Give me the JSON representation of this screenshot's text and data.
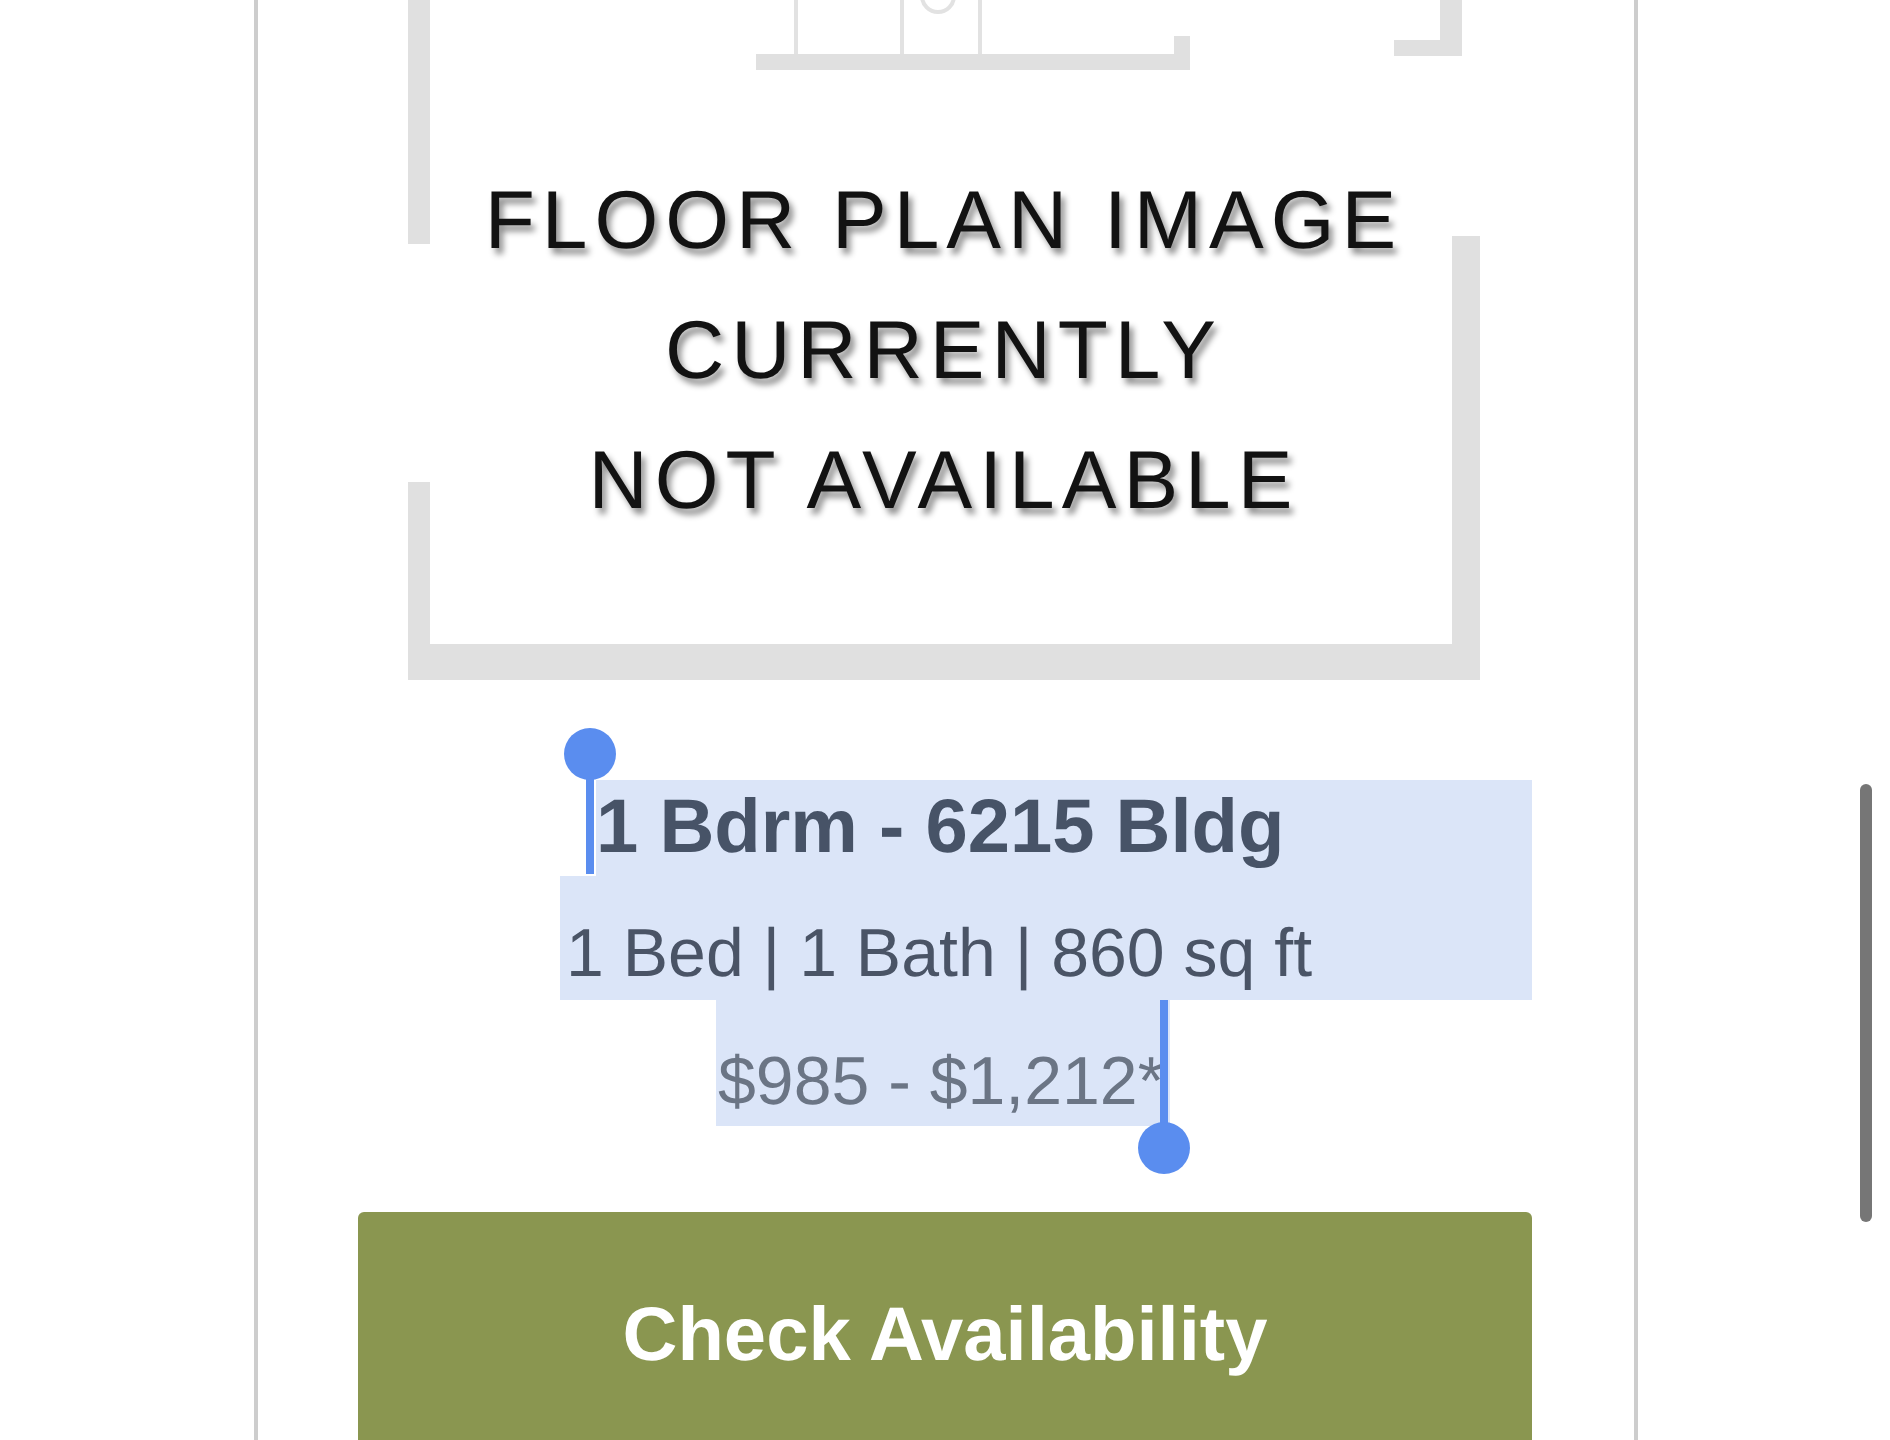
{
  "floor_plan_image": {
    "lines": [
      "FLOOR PLAN IMAGE",
      "CURRENTLY",
      "NOT AVAILABLE"
    ]
  },
  "unit_info": [
    {
      "kind": "title",
      "text": "1 Bdrm - 6215 Bldg",
      "selected": true
    },
    {
      "kind": "details",
      "text": "1 Bed | 1 Bath | 860 sq ft",
      "selected": true
    },
    {
      "kind": "price",
      "text": "$985 - $1,212*",
      "selected": true
    }
  ],
  "button": {
    "label": "Check Availability"
  }
}
